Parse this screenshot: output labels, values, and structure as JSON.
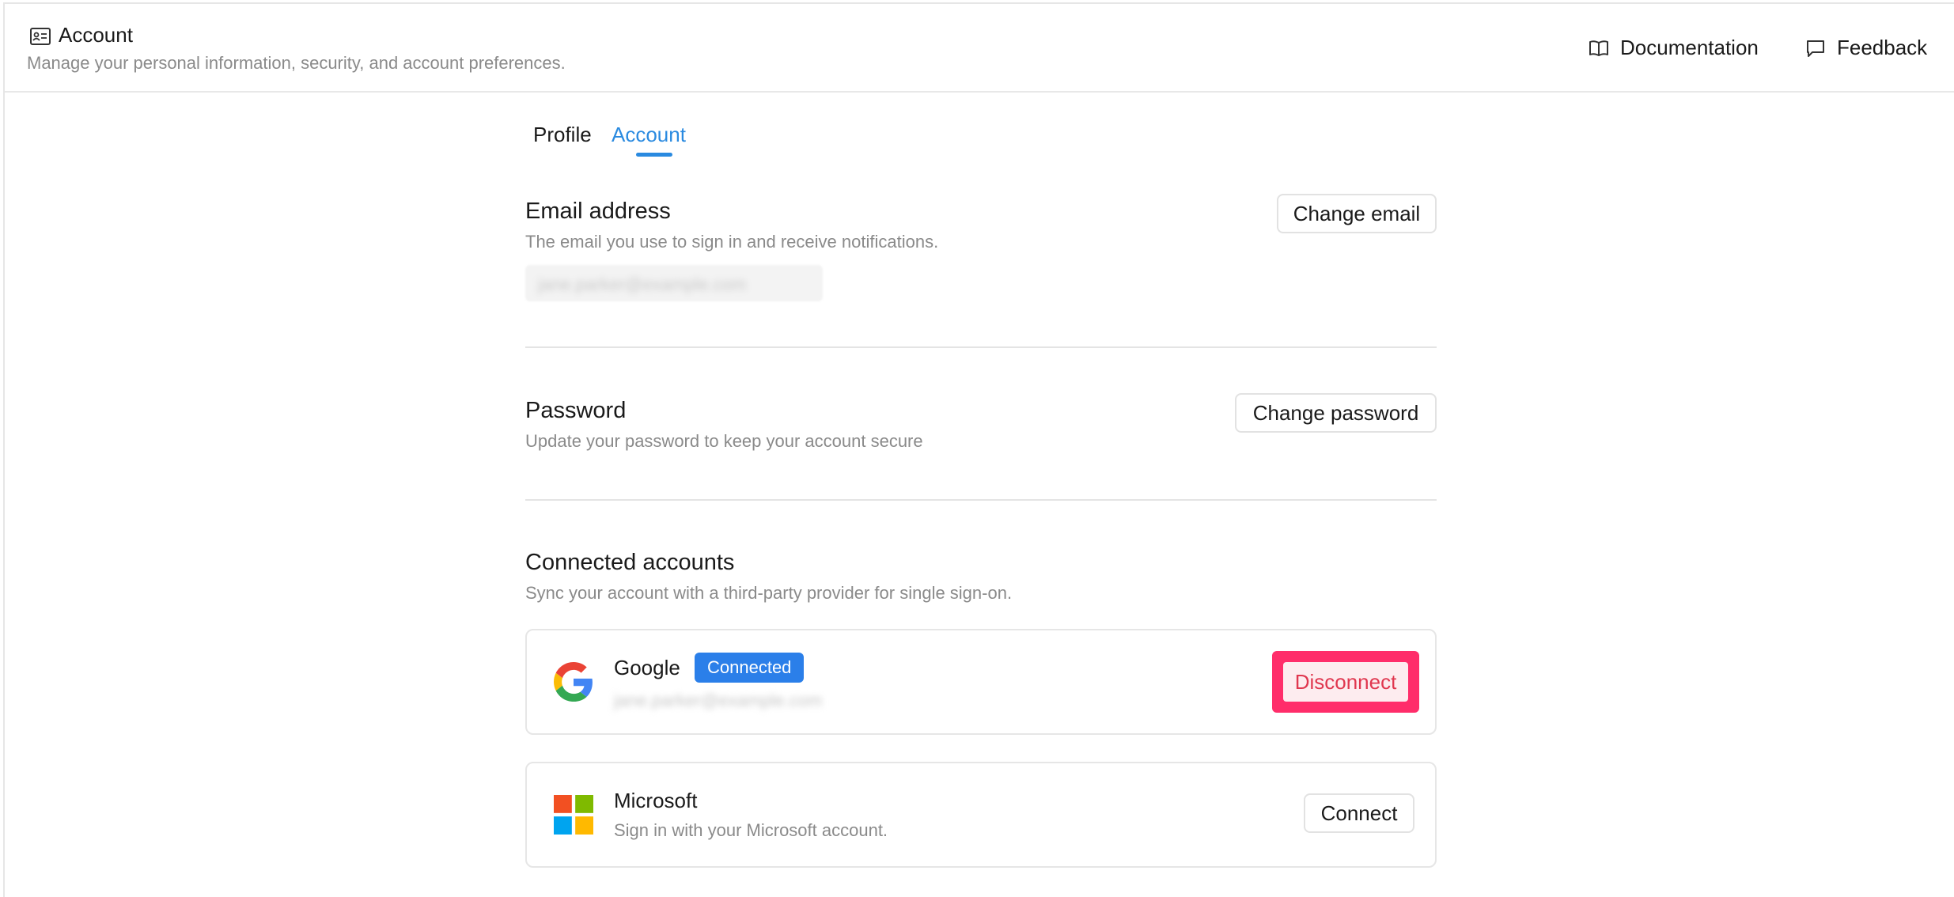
{
  "header": {
    "title": "Account",
    "subtitle": "Manage your personal information, security, and account preferences.",
    "links": {
      "documentation": "Documentation",
      "feedback": "Feedback"
    }
  },
  "tabs": {
    "profile": "Profile",
    "account": "Account",
    "active": "Account"
  },
  "email_section": {
    "title": "Email address",
    "description": "The email you use to sign in and receive notifications.",
    "button": "Change email",
    "value": "jane.parker@example.com"
  },
  "password_section": {
    "title": "Password",
    "description": "Update your password to keep your account secure",
    "button": "Change password"
  },
  "connected_section": {
    "title": "Connected accounts",
    "description": "Sync your account with a third-party provider for single sign-on.",
    "providers": [
      {
        "name": "Google",
        "icon": "google-icon",
        "status": "Connected",
        "email": "jane.parker@example.com",
        "button": "Disconnect"
      },
      {
        "name": "Microsoft",
        "icon": "microsoft-icon",
        "description": "Sign in with your Microsoft account.",
        "button": "Connect"
      }
    ]
  },
  "colors": {
    "accent": "#2a8ae0",
    "badge": "#2b7fe9",
    "highlight": "#ff2d6a",
    "danger_text": "#e0374f"
  }
}
